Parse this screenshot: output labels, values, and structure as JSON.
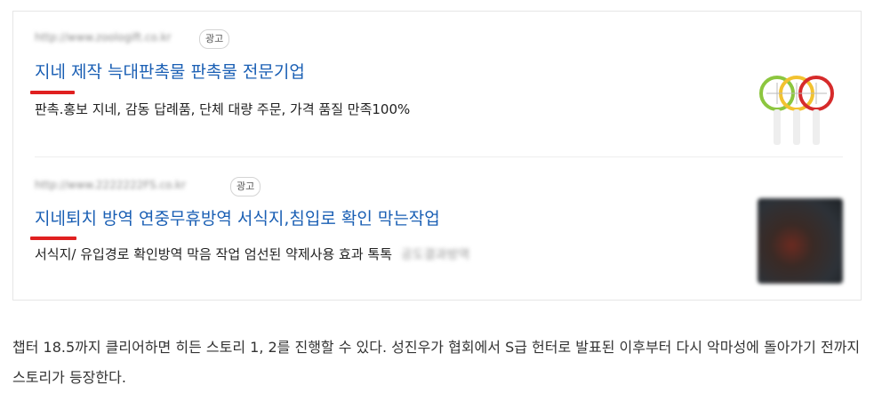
{
  "ads": [
    {
      "url": "http://www.zoologift.co.kr",
      "badge": "광고",
      "title": "지네 제작 늑대판촉물 판촉물 전문기업",
      "description": "판촉.홍보 지네, 감동 답례품, 단체 대량 주문, 가격 품질 만족100%",
      "thumbnail_icon": "electric-swatter-image"
    },
    {
      "url": "http://www.2222222FS.co.kr",
      "badge": "광고",
      "title": "지네퇴치 방역 연중무휴방역 서식지,침입로 확인 막는작업",
      "description": "서식지/ 유입경로 확인방역 막음 작업 엄선된 약제사용 효과 톡톡",
      "blurred_tail": "공도결과방역",
      "thumbnail_icon": "pest-photo-image"
    }
  ],
  "article": {
    "paragraph": "챕터 18.5까지 클리어하면 히든 스토리 1, 2를 진행할 수 있다. 성진우가 협회에서 S급 헌터로 발표된 이후부터 다시 악마성에 돌아가기 전까지 스토리가 등장한다."
  },
  "colors": {
    "link": "#1a5fb4",
    "highlight_underline": "#e02020"
  }
}
